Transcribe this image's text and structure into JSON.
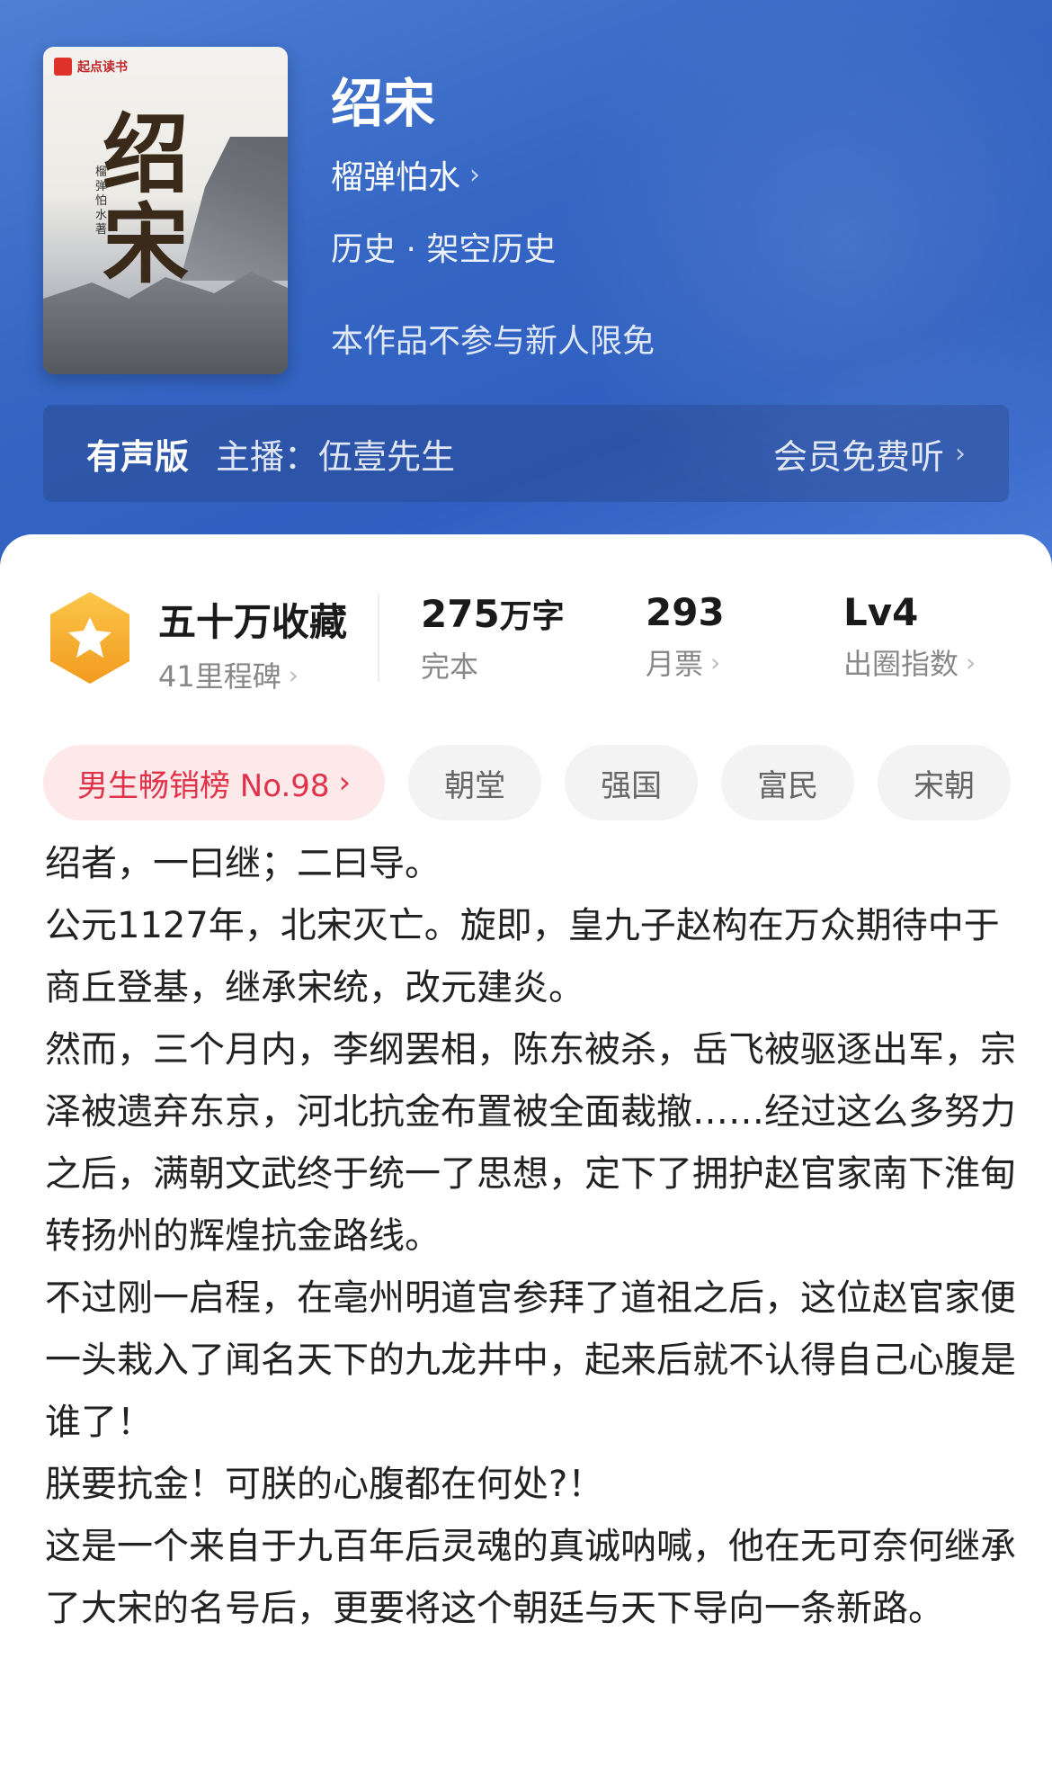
{
  "book": {
    "cover_brand": "起点读书",
    "cover_title": "绍宋",
    "cover_author": "榴弹怕水著",
    "title": "绍宋",
    "author": "榴弹怕水",
    "category": "历史 · 架空历史",
    "notice": "本作品不参与新人限免"
  },
  "audio": {
    "label": "有声版",
    "anchor": "主播：伍壹先生",
    "action": "会员免费听"
  },
  "stats": {
    "collect_main": "五十万收藏",
    "collect_sub": "41里程碑",
    "words_num": "275",
    "words_unit": "万字",
    "words_sub": "完本",
    "tickets_num": "293",
    "tickets_sub": "月票",
    "level_main": "Lv4",
    "level_sub": "出圈指数"
  },
  "tags": {
    "rank": "男生畅销榜 No.98",
    "items": [
      "朝堂",
      "强国",
      "富民",
      "宋朝"
    ]
  },
  "intro": [
    "绍者，一曰继；二曰导。",
    "公元1127年，北宋灭亡。旋即，皇九子赵构在万众期待中于商丘登基，继承宋统，改元建炎。",
    "然而，三个月内，李纲罢相，陈东被杀，岳飞被驱逐出军，宗泽被遗弃东京，河北抗金布置被全面裁撤……经过这么多努力之后，满朝文武终于统一了思想，定下了拥护赵官家南下淮甸转扬州的辉煌抗金路线。",
    "不过刚一启程，在亳州明道宫参拜了道祖之后，这位赵官家便一头栽入了闻名天下的九龙井中，起来后就不认得自己心腹是谁了！",
    "朕要抗金！可朕的心腹都在何处?！",
    "这是一个来自于九百年后灵魂的真诚呐喊，他在无可奈何继承了大宋的名号后，更要将这个朝廷与天下导向一条新路。"
  ]
}
